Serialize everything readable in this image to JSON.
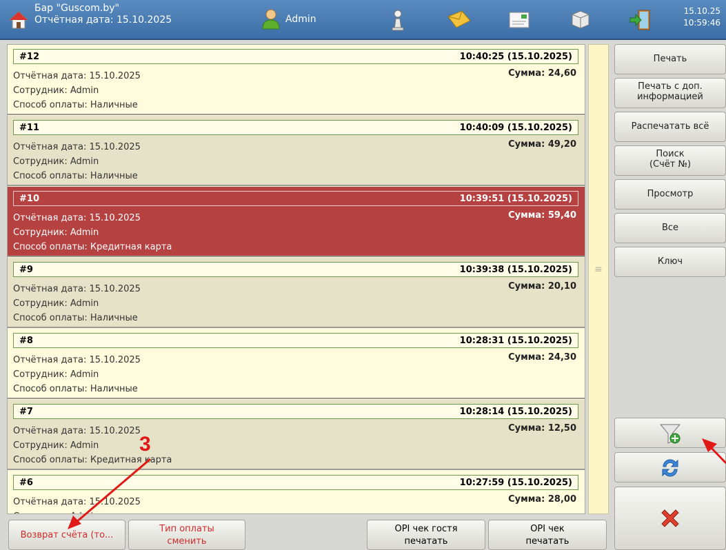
{
  "header": {
    "venue": "Бар \"Guscom.by\"",
    "report_date": "Отчётная дата: 15.10.2025",
    "user": "Admin",
    "date": "15.10.25",
    "time": "10:59:46",
    "icons": [
      "home-icon",
      "user-icon",
      "pawn-icon",
      "envelope-icon",
      "invoice-icon",
      "box-icon",
      "exit-icon"
    ]
  },
  "receipts": [
    {
      "num": "#12",
      "time": "10:40:25 (15.10.2025)",
      "date": "Отчётная дата: 15.10.2025",
      "employee": "Сотрудник: Admin",
      "payment": "Способ оплаты: Наличные",
      "sum": "Сумма: 24,60",
      "style": "light"
    },
    {
      "num": "#11",
      "time": "10:40:09 (15.10.2025)",
      "date": "Отчётная дата: 15.10.2025",
      "employee": "Сотрудник: Admin",
      "payment": "Способ оплаты: Наличные",
      "sum": "Сумма: 49,20",
      "style": "dark"
    },
    {
      "num": "#10",
      "time": "10:39:51 (15.10.2025)",
      "date": "Отчётная дата: 15.10.2025",
      "employee": "Сотрудник: Admin",
      "payment": "Способ оплаты: Кредитная карта",
      "sum": "Сумма: 59,40",
      "style": "sel"
    },
    {
      "num": "#9",
      "time": "10:39:38 (15.10.2025)",
      "date": "Отчётная дата: 15.10.2025",
      "employee": "Сотрудник: Admin",
      "payment": "Способ оплаты: Наличные",
      "sum": "Сумма: 20,10",
      "style": "dark"
    },
    {
      "num": "#8",
      "time": "10:28:31 (15.10.2025)",
      "date": "Отчётная дата: 15.10.2025",
      "employee": "Сотрудник: Admin",
      "payment": "Способ оплаты: Наличные",
      "sum": "Сумма: 24,30",
      "style": "light"
    },
    {
      "num": "#7",
      "time": "10:28:14 (15.10.2025)",
      "date": "Отчётная дата: 15.10.2025",
      "employee": "Сотрудник: Admin",
      "payment": "Способ оплаты: Кредитная карта",
      "sum": "Сумма: 12,50",
      "style": "dark"
    },
    {
      "num": "#6",
      "time": "10:27:59 (15.10.2025)",
      "date": "Отчётная дата: 15.10.2025",
      "employee": "Сотрудник: Admin",
      "payment": "",
      "sum": "Сумма: 28,00",
      "style": "light"
    }
  ],
  "side_buttons": {
    "print": "Печать",
    "print_extra_1": "Печать с доп.",
    "print_extra_2": "информацией",
    "print_all": "Распечатать всё",
    "search_1": "Поиск",
    "search_2": "(Счёт №)",
    "view": "Просмотр",
    "all": "Все",
    "key": "Ключ"
  },
  "bottom_buttons": {
    "refund": "Возврат счёта (то...",
    "paytype_1": "Тип оплаты",
    "paytype_2": "сменить",
    "opi_guest_1": "OPI чек гостя",
    "opi_guest_2": "печатать",
    "opi_1": "OPI чек",
    "opi_2": "печатать"
  },
  "annotation": {
    "label": "3"
  },
  "colors": {
    "selected": "#b54141",
    "header": "#3b6ea6",
    "arrow": "#e01818"
  }
}
